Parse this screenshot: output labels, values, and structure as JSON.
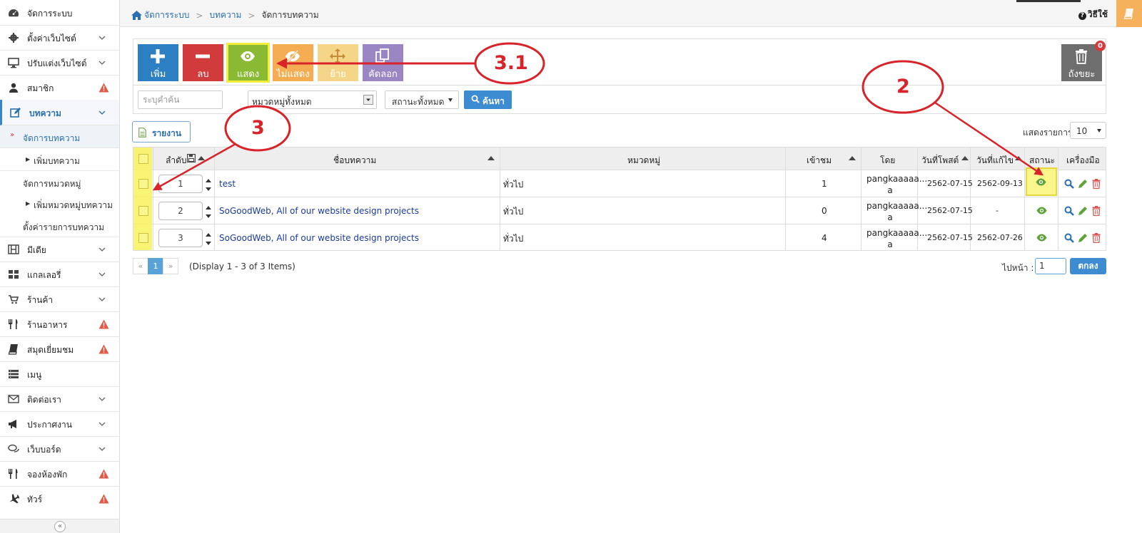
{
  "sidebar": {
    "items": [
      {
        "label": "จัดการระบบ"
      },
      {
        "label": "ตั้งค่าเว็บไซต์"
      },
      {
        "label": "ปรับแต่งเว็บไซต์"
      },
      {
        "label": "สมาชิก"
      },
      {
        "label": "บทความ"
      },
      {
        "label": "มีเดีย"
      },
      {
        "label": "แกลเลอรี่"
      },
      {
        "label": "ร้านค้า"
      },
      {
        "label": "ร้านอาหาร"
      },
      {
        "label": "สมุดเยี่ยมชม"
      },
      {
        "label": "เมนู"
      },
      {
        "label": "ติดต่อเรา"
      },
      {
        "label": "ประกาศงาน"
      },
      {
        "label": "เว็บบอร์ด"
      },
      {
        "label": "จองห้องพัก"
      },
      {
        "label": "ทัวร์"
      }
    ],
    "subitems": [
      {
        "label": "จัดการบทความ"
      },
      {
        "label": "เพิ่มบทความ"
      },
      {
        "label": "จัดการหมวดหมู่"
      },
      {
        "label": "เพิ่มหมวดหมู่บทความ"
      },
      {
        "label": "ตั้งค่ารายการบทความ"
      }
    ],
    "collapse_glyph": "«"
  },
  "breadcrumb": {
    "items": [
      "จัดการระบบ",
      "บทความ",
      "จัดการบทความ"
    ],
    "separator": ">"
  },
  "help": {
    "label": "วิธีใช้",
    "glyph": "?"
  },
  "toolbar": {
    "add": "เพิ่ม",
    "delete": "ลบ",
    "show": "แสดง",
    "hide": "ไม่แสดง",
    "move": "ย้าย",
    "copy": "คัดลอก",
    "trash": "ถังขยะ",
    "trash_count": "0"
  },
  "filters": {
    "search_placeholder": "ระบุคำค้น",
    "category": "หมวดหมู่ทั้งหมด",
    "status": "สถานะทั้งหมด",
    "search_button": "ค้นหา"
  },
  "report_button": "รายงาน",
  "page_size": {
    "label": "แสดงรายการ",
    "value": "10"
  },
  "table": {
    "headers": {
      "order": "ลำดับ",
      "title": "ชื่อบทความ",
      "category": "หมวดหมู่",
      "views": "เข้าชม",
      "by": "โดย",
      "posted": "วันที่โพสต์",
      "edited": "วันที่แก้ไข",
      "status": "สถานะ",
      "tools": "เครื่องมือ"
    },
    "rows": [
      {
        "order": "1",
        "title": "test",
        "category": "ทั่วไป",
        "views": "1",
        "by_line1": "pangkaaaaa...",
        "by_line2": "a",
        "posted": "2562-07-15",
        "edited": "2562-09-13"
      },
      {
        "order": "2",
        "title": "SoGoodWeb, All of our website design projects",
        "category": "ทั่วไป",
        "views": "0",
        "by_line1": "pangkaaaaa...",
        "by_line2": "a",
        "posted": "2562-07-15",
        "edited": "-"
      },
      {
        "order": "3",
        "title": "SoGoodWeb, All of our website design projects",
        "category": "ทั่วไป",
        "views": "4",
        "by_line1": "pangkaaaaa...",
        "by_line2": "a",
        "posted": "2562-07-15",
        "edited": "2562-07-26"
      }
    ]
  },
  "pagination": {
    "prev": "«",
    "current": "1",
    "next": "»",
    "info": "(Display 1 - 3 of 3 Items)",
    "goto_label": "ไปหน้า :",
    "goto_value": "1",
    "goto_button": "ตกลง"
  },
  "annotations": {
    "a1": "3.1",
    "a2": "2",
    "a3": "3"
  },
  "colors": {
    "accent": "#2c7fc3",
    "danger": "#d23b3b",
    "success": "#8ab934",
    "annotation": "#d8232a",
    "highlight": "#f3ee3b"
  }
}
